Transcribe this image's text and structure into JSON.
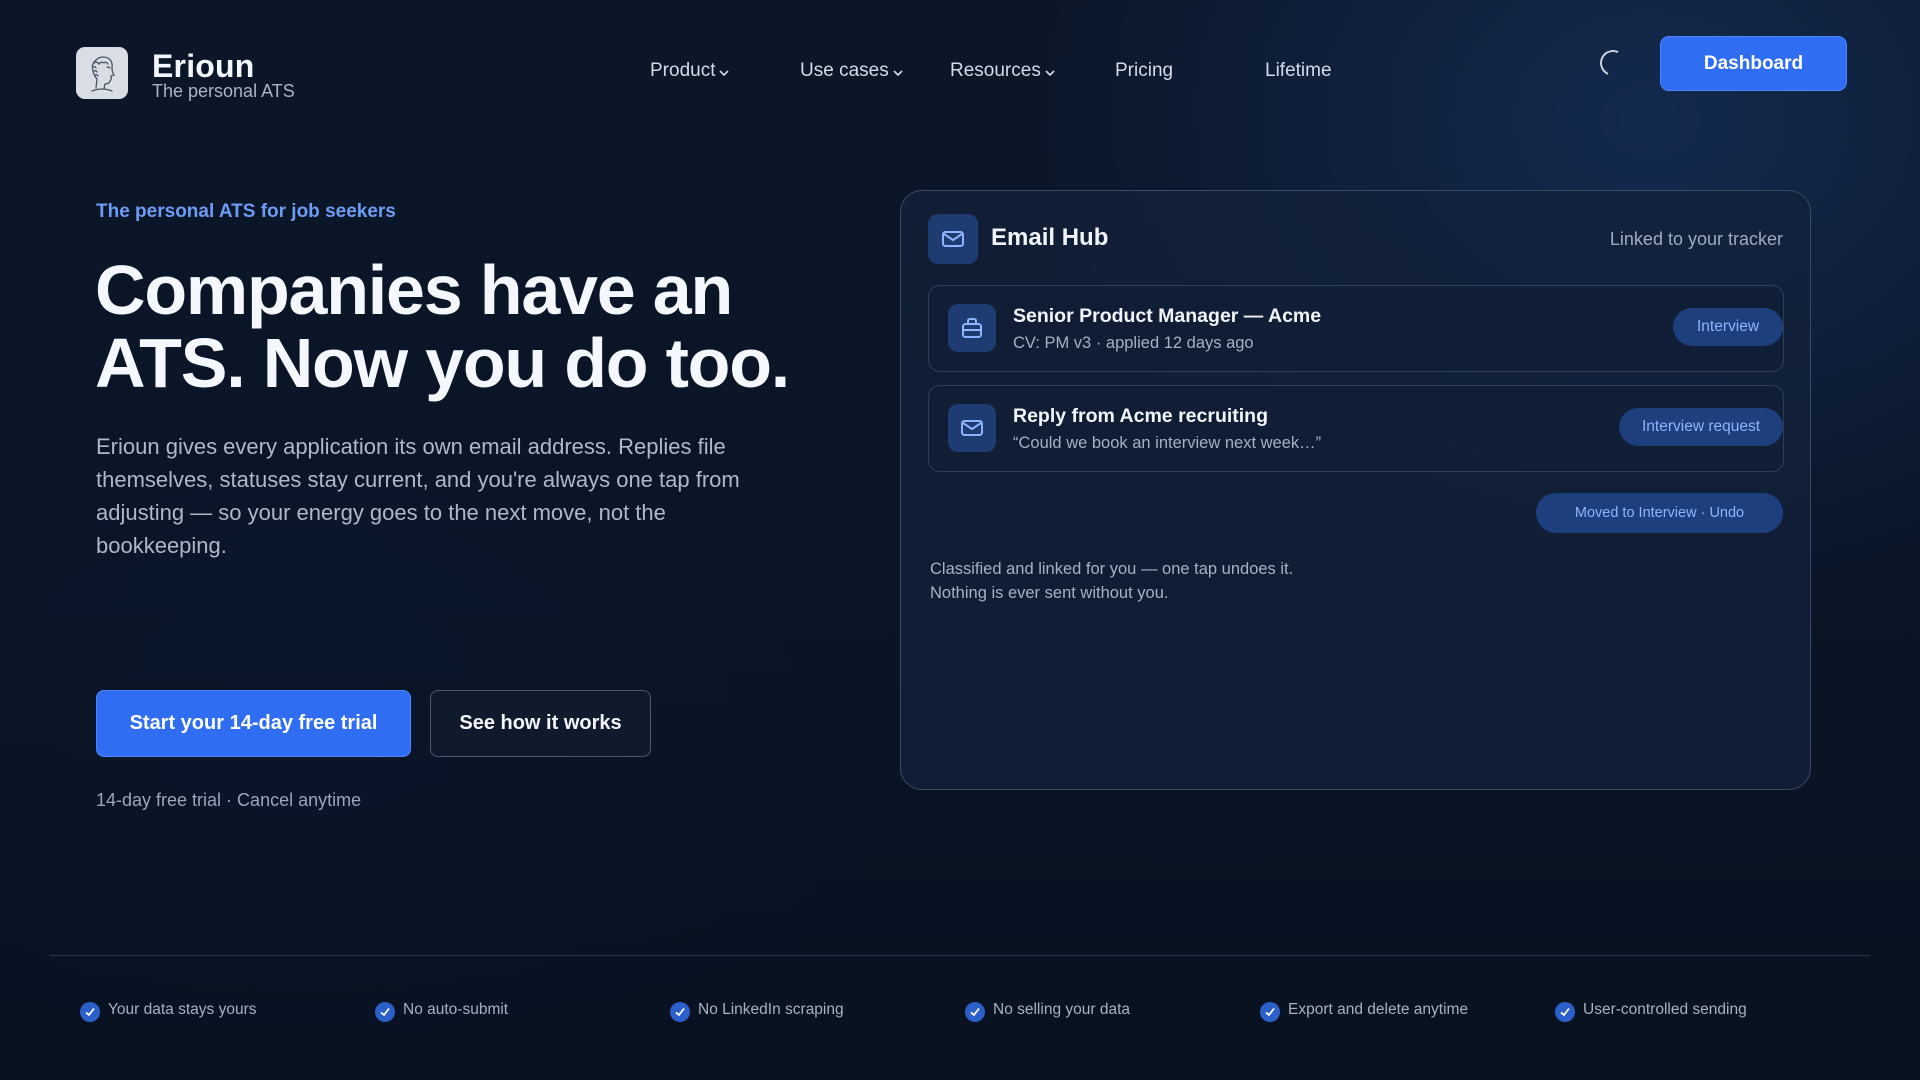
{
  "brand": {
    "name": "Erioun",
    "tagline": "The personal ATS",
    "logo_icon": "greek-head-icon"
  },
  "nav": [
    {
      "label": "Product",
      "has_dropdown": true
    },
    {
      "label": "Use cases",
      "has_dropdown": true
    },
    {
      "label": "Resources",
      "has_dropdown": true
    },
    {
      "label": "Pricing",
      "has_dropdown": false
    },
    {
      "label": "Lifetime",
      "has_dropdown": false
    }
  ],
  "header": {
    "dashboard_label": "Dashboard",
    "loading_icon": "spinner-icon"
  },
  "hero": {
    "eyebrow": "The personal ATS for job seekers",
    "title_line1": "Companies have an",
    "title_line2": "ATS. Now you do too.",
    "description": "Erioun gives every application its own email address. Replies file themselves, statuses stay current, and you're always one tap from adjusting — so your energy goes to the next move, not the bookkeeping.",
    "cta_primary": "Start your 14-day free trial",
    "cta_secondary": "See how it works",
    "trial_note": "14-day free trial · Cancel anytime"
  },
  "email_hub": {
    "title": "Email Hub",
    "linked_text": "Linked to your tracker",
    "rows": [
      {
        "icon": "briefcase-icon",
        "title": "Senior Product Manager — Acme",
        "subtitle": "CV: PM v3 · applied 12 days ago",
        "badge": "Interview"
      },
      {
        "icon": "mail-icon",
        "title": "Reply from Acme recruiting",
        "subtitle": "“Could we book an interview next week…”",
        "badge": "Interview request"
      }
    ],
    "moved_text": "Moved to Interview · Undo",
    "footnote_line1": "Classified and linked for you — one tap undoes it.",
    "footnote_line2": "Nothing is ever sent without you."
  },
  "trust": [
    "Your data stays yours",
    "No auto-submit",
    "No LinkedIn scraping",
    "No selling your data",
    "Export and delete anytime",
    "User-controlled sending"
  ],
  "colors": {
    "accent": "#2f6ef2",
    "eyebrow": "#6d9cf5",
    "pill_bg": "#1d3f7e",
    "pill_text": "#8db4ff",
    "background": "#0b1628"
  }
}
